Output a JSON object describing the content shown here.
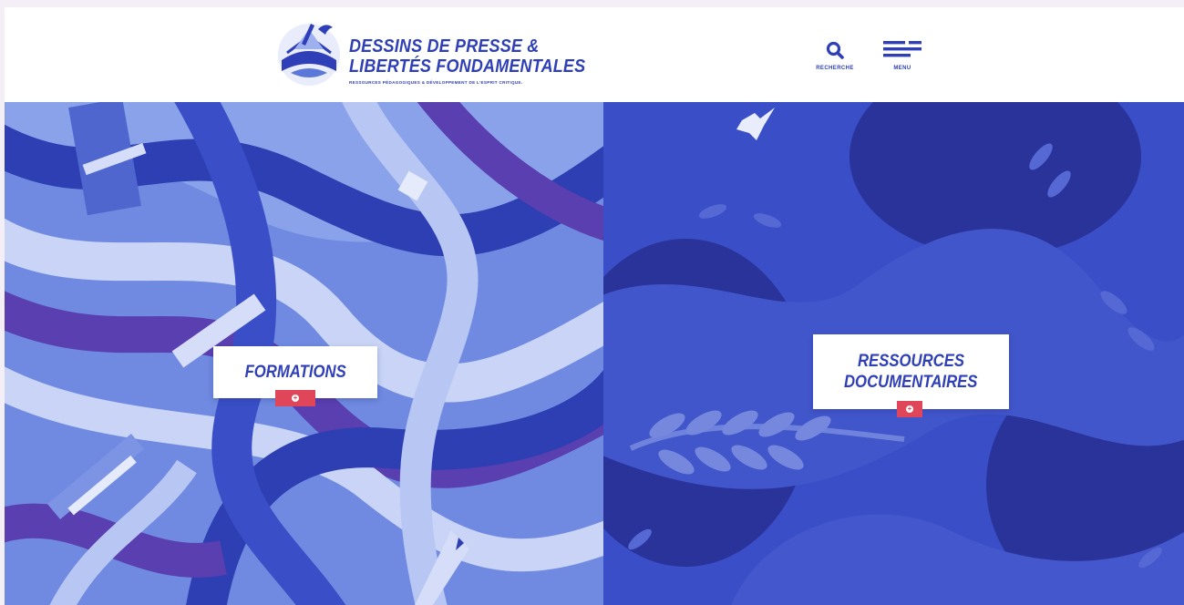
{
  "header": {
    "logo": {
      "line1": "DESSINS DE PRESSE &",
      "line2": "LIBERTÉS FONDAMENTALES",
      "tagline": "RESSOURCES PÉDAGOGIQUES & DÉVELOPPEMENT DE L'ESPRIT CRITIQUE."
    },
    "search": {
      "label": "RECHERCHE",
      "icon": "search-icon"
    },
    "menu": {
      "label": "MENU",
      "icon": "hamburger-menu-icon"
    }
  },
  "panels": [
    {
      "title": "FORMATIONS",
      "button_icon": "plus-icon"
    },
    {
      "title_line1": "RESSOURCES",
      "title_line2": "DOCUMENTAIRES",
      "button_icon": "plus-icon"
    }
  ],
  "colors": {
    "brand_blue": "#2f3fb8",
    "accent_red": "#e0465a",
    "left_panel": "#5b78d8",
    "right_panel": "#3a4fc7",
    "page_bg": "#f4eef6"
  }
}
